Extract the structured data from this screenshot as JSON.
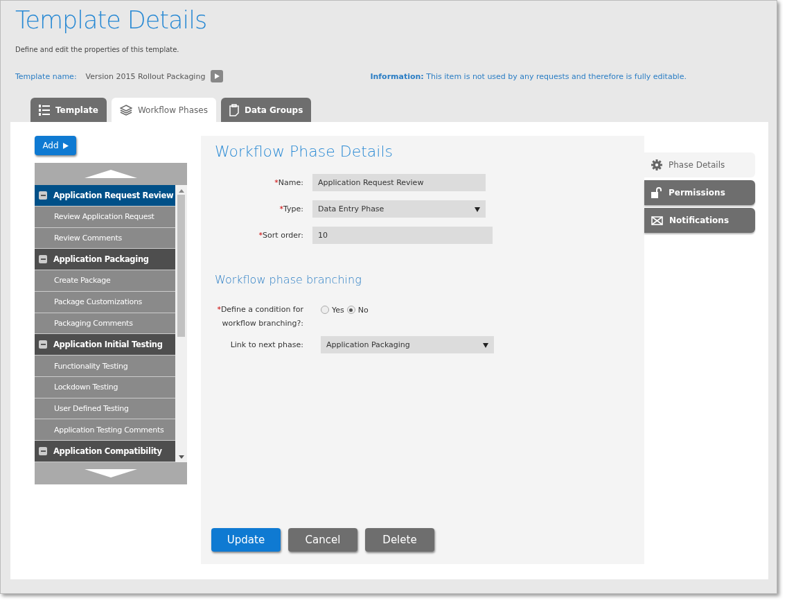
{
  "header": {
    "title": "Template Details",
    "description": "Define and edit the properties of this template.",
    "template_name_label": "Template name:",
    "template_name": "Version 2015 Rollout Packaging",
    "info": "**Information:** This item is not used by any requests and therefore is fully editable."
  },
  "tabs": [
    {
      "label": "Template",
      "selected": false
    },
    {
      "label": "Workflow Phases",
      "selected": true
    },
    {
      "label": "Data Groups",
      "selected": false
    }
  ],
  "add_button": "Add",
  "tree": [
    {
      "label": "Application Request Review",
      "expanded": true,
      "selected": true,
      "children": [
        {
          "label": "Review Application Request",
          "selected": false
        },
        {
          "label": "Review Comments",
          "selected": false
        }
      ]
    },
    {
      "label": "Application Packaging",
      "expanded": true,
      "selected": false,
      "children": [
        {
          "label": "Create Package",
          "selected": false
        },
        {
          "label": "Package Customizations",
          "selected": false
        },
        {
          "label": "Packaging Comments",
          "selected": false
        }
      ]
    },
    {
      "label": "Application Initial Testing",
      "expanded": true,
      "selected": false,
      "children": [
        {
          "label": "Functionality Testing",
          "selected": false
        },
        {
          "label": "Lockdown Testing",
          "selected": false
        },
        {
          "label": "User Defined Testing",
          "selected": false
        },
        {
          "label": "Application Testing Comments",
          "selected": false
        }
      ]
    },
    {
      "label": "Application Compatibility",
      "expanded": true,
      "selected": false
    }
  ],
  "details": {
    "title": "Workflow Phase Details",
    "fields": [
      {
        "marker": "*",
        "label": "Name:",
        "kind": "text",
        "value": "Application Request Review"
      },
      {
        "marker": "*",
        "label": "Type:",
        "kind": "select",
        "value": "Data Entry Phase"
      },
      {
        "marker": "*",
        "label": "Sort order:",
        "kind": "text",
        "value": "10"
      }
    ],
    "branching_title": "Workflow phase branching",
    "condition": {
      "marker": "*",
      "label": "Define a condition for workflow branching?:",
      "options": [
        {
          "label": "Yes",
          "selected": false
        },
        {
          "label": "No",
          "selected": true
        }
      ]
    },
    "link": {
      "label": "Link to next phase:",
      "value": "Application Packaging"
    },
    "buttons": [
      {
        "label": "Update",
        "kind": "primary"
      },
      {
        "label": "Cancel",
        "kind": "secondary"
      },
      {
        "label": "Delete",
        "kind": "secondary"
      }
    ]
  },
  "side_tabs": [
    {
      "label": "Phase Details",
      "selected": true
    },
    {
      "label": "Permissions",
      "selected": false
    },
    {
      "label": "Notifications",
      "selected": false
    }
  ]
}
